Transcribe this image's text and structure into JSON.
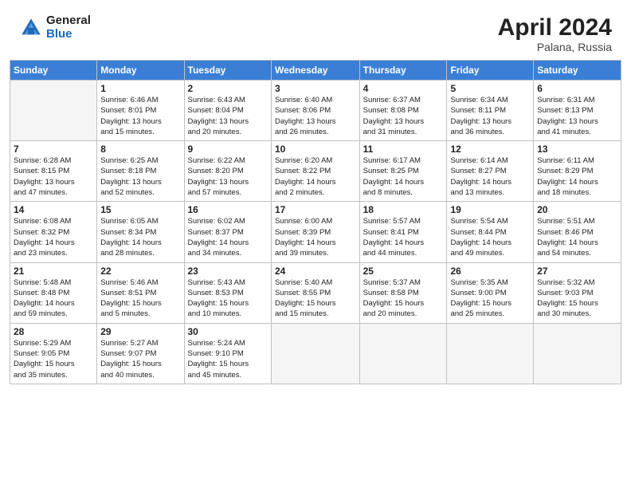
{
  "header": {
    "logo_general": "General",
    "logo_blue": "Blue",
    "title": "April 2024",
    "location": "Palana, Russia"
  },
  "days_of_week": [
    "Sunday",
    "Monday",
    "Tuesday",
    "Wednesday",
    "Thursday",
    "Friday",
    "Saturday"
  ],
  "weeks": [
    [
      {
        "day": "",
        "info": ""
      },
      {
        "day": "1",
        "info": "Sunrise: 6:46 AM\nSunset: 8:01 PM\nDaylight: 13 hours\nand 15 minutes."
      },
      {
        "day": "2",
        "info": "Sunrise: 6:43 AM\nSunset: 8:04 PM\nDaylight: 13 hours\nand 20 minutes."
      },
      {
        "day": "3",
        "info": "Sunrise: 6:40 AM\nSunset: 8:06 PM\nDaylight: 13 hours\nand 26 minutes."
      },
      {
        "day": "4",
        "info": "Sunrise: 6:37 AM\nSunset: 8:08 PM\nDaylight: 13 hours\nand 31 minutes."
      },
      {
        "day": "5",
        "info": "Sunrise: 6:34 AM\nSunset: 8:11 PM\nDaylight: 13 hours\nand 36 minutes."
      },
      {
        "day": "6",
        "info": "Sunrise: 6:31 AM\nSunset: 8:13 PM\nDaylight: 13 hours\nand 41 minutes."
      }
    ],
    [
      {
        "day": "7",
        "info": "Sunrise: 6:28 AM\nSunset: 8:15 PM\nDaylight: 13 hours\nand 47 minutes."
      },
      {
        "day": "8",
        "info": "Sunrise: 6:25 AM\nSunset: 8:18 PM\nDaylight: 13 hours\nand 52 minutes."
      },
      {
        "day": "9",
        "info": "Sunrise: 6:22 AM\nSunset: 8:20 PM\nDaylight: 13 hours\nand 57 minutes."
      },
      {
        "day": "10",
        "info": "Sunrise: 6:20 AM\nSunset: 8:22 PM\nDaylight: 14 hours\nand 2 minutes."
      },
      {
        "day": "11",
        "info": "Sunrise: 6:17 AM\nSunset: 8:25 PM\nDaylight: 14 hours\nand 8 minutes."
      },
      {
        "day": "12",
        "info": "Sunrise: 6:14 AM\nSunset: 8:27 PM\nDaylight: 14 hours\nand 13 minutes."
      },
      {
        "day": "13",
        "info": "Sunrise: 6:11 AM\nSunset: 8:29 PM\nDaylight: 14 hours\nand 18 minutes."
      }
    ],
    [
      {
        "day": "14",
        "info": "Sunrise: 6:08 AM\nSunset: 8:32 PM\nDaylight: 14 hours\nand 23 minutes."
      },
      {
        "day": "15",
        "info": "Sunrise: 6:05 AM\nSunset: 8:34 PM\nDaylight: 14 hours\nand 28 minutes."
      },
      {
        "day": "16",
        "info": "Sunrise: 6:02 AM\nSunset: 8:37 PM\nDaylight: 14 hours\nand 34 minutes."
      },
      {
        "day": "17",
        "info": "Sunrise: 6:00 AM\nSunset: 8:39 PM\nDaylight: 14 hours\nand 39 minutes."
      },
      {
        "day": "18",
        "info": "Sunrise: 5:57 AM\nSunset: 8:41 PM\nDaylight: 14 hours\nand 44 minutes."
      },
      {
        "day": "19",
        "info": "Sunrise: 5:54 AM\nSunset: 8:44 PM\nDaylight: 14 hours\nand 49 minutes."
      },
      {
        "day": "20",
        "info": "Sunrise: 5:51 AM\nSunset: 8:46 PM\nDaylight: 14 hours\nand 54 minutes."
      }
    ],
    [
      {
        "day": "21",
        "info": "Sunrise: 5:48 AM\nSunset: 8:48 PM\nDaylight: 14 hours\nand 59 minutes."
      },
      {
        "day": "22",
        "info": "Sunrise: 5:46 AM\nSunset: 8:51 PM\nDaylight: 15 hours\nand 5 minutes."
      },
      {
        "day": "23",
        "info": "Sunrise: 5:43 AM\nSunset: 8:53 PM\nDaylight: 15 hours\nand 10 minutes."
      },
      {
        "day": "24",
        "info": "Sunrise: 5:40 AM\nSunset: 8:55 PM\nDaylight: 15 hours\nand 15 minutes."
      },
      {
        "day": "25",
        "info": "Sunrise: 5:37 AM\nSunset: 8:58 PM\nDaylight: 15 hours\nand 20 minutes."
      },
      {
        "day": "26",
        "info": "Sunrise: 5:35 AM\nSunset: 9:00 PM\nDaylight: 15 hours\nand 25 minutes."
      },
      {
        "day": "27",
        "info": "Sunrise: 5:32 AM\nSunset: 9:03 PM\nDaylight: 15 hours\nand 30 minutes."
      }
    ],
    [
      {
        "day": "28",
        "info": "Sunrise: 5:29 AM\nSunset: 9:05 PM\nDaylight: 15 hours\nand 35 minutes."
      },
      {
        "day": "29",
        "info": "Sunrise: 5:27 AM\nSunset: 9:07 PM\nDaylight: 15 hours\nand 40 minutes."
      },
      {
        "day": "30",
        "info": "Sunrise: 5:24 AM\nSunset: 9:10 PM\nDaylight: 15 hours\nand 45 minutes."
      },
      {
        "day": "",
        "info": ""
      },
      {
        "day": "",
        "info": ""
      },
      {
        "day": "",
        "info": ""
      },
      {
        "day": "",
        "info": ""
      }
    ]
  ]
}
